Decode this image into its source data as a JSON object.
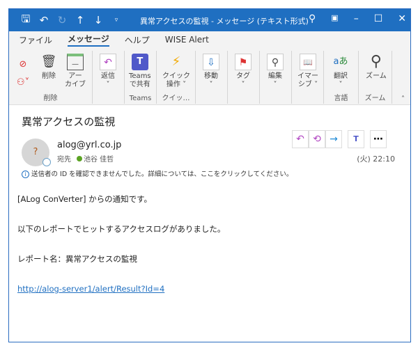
{
  "window": {
    "title": "異常アクセスの監視 - メッセージ (テキスト形式)"
  },
  "quick_access": [
    "save-icon",
    "undo-icon",
    "redo-icon",
    "up-icon",
    "down-icon",
    "customize-icon"
  ],
  "tabs": [
    {
      "label": "ファイル"
    },
    {
      "label": "メッセージ",
      "active": true
    },
    {
      "label": "ヘルプ"
    },
    {
      "label": "WISE Alert"
    }
  ],
  "ribbon": {
    "delete_group": {
      "label": "削除",
      "delete": "削除",
      "archive1": "アー",
      "archive2": "カイブ"
    },
    "reply": {
      "label": "返信"
    },
    "teams": {
      "share1": "Teams",
      "share2": "で共有",
      "label": "Teams"
    },
    "quick": {
      "label1": "クイック",
      "label2": "操作",
      "group": "クイッ…"
    },
    "move": "移動",
    "tags": "タグ",
    "edit": "編集",
    "immersive1": "イマー",
    "immersive2": "シブ",
    "translate": "翻訳",
    "lang_group": "言語",
    "zoom": "ズーム",
    "zoom_group": "ズーム"
  },
  "message": {
    "subject": "異常アクセスの監視",
    "avatar": "?",
    "from": "alog@yrl.co.jp",
    "to_label": "宛先",
    "to": "池谷 佳哲",
    "time": "(火) 22:10",
    "info": "送信者の ID を確認できませんでした。詳細については、ここをクリックしてください。",
    "body": [
      "[ALog ConVerter] からの通知です。",
      "以下のレポートでヒットするアクセスログがありました。",
      "レポート名：異常アクセスの監視"
    ],
    "link": "http://alog-server1/alert/Result?Id=4"
  },
  "colors": {
    "titlebar": "#1f6fc1",
    "reply": "#b146c2",
    "forward": "#1f8ad6",
    "teams": "#5059c9"
  }
}
